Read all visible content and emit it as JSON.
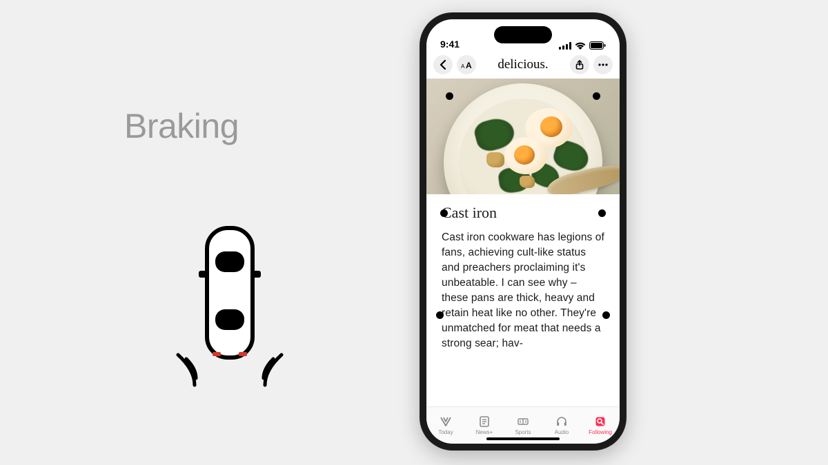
{
  "left_panel": {
    "label": "Braking"
  },
  "phone": {
    "status": {
      "time": "9:41"
    },
    "nav": {
      "title": "delicious."
    },
    "article": {
      "title": "Cast iron",
      "body": "Cast iron cookware has legions of fans, achieving cult-like status and preachers proclaiming it's unbeatable. I can see why – these pans are thick, heavy and retain heat like no other. They're unmatched for meat that needs a strong sear; hav-"
    },
    "tabs": {
      "today": "Today",
      "newsplus": "News+",
      "sports": "Sports",
      "audio": "Audio",
      "following": "Following"
    }
  }
}
